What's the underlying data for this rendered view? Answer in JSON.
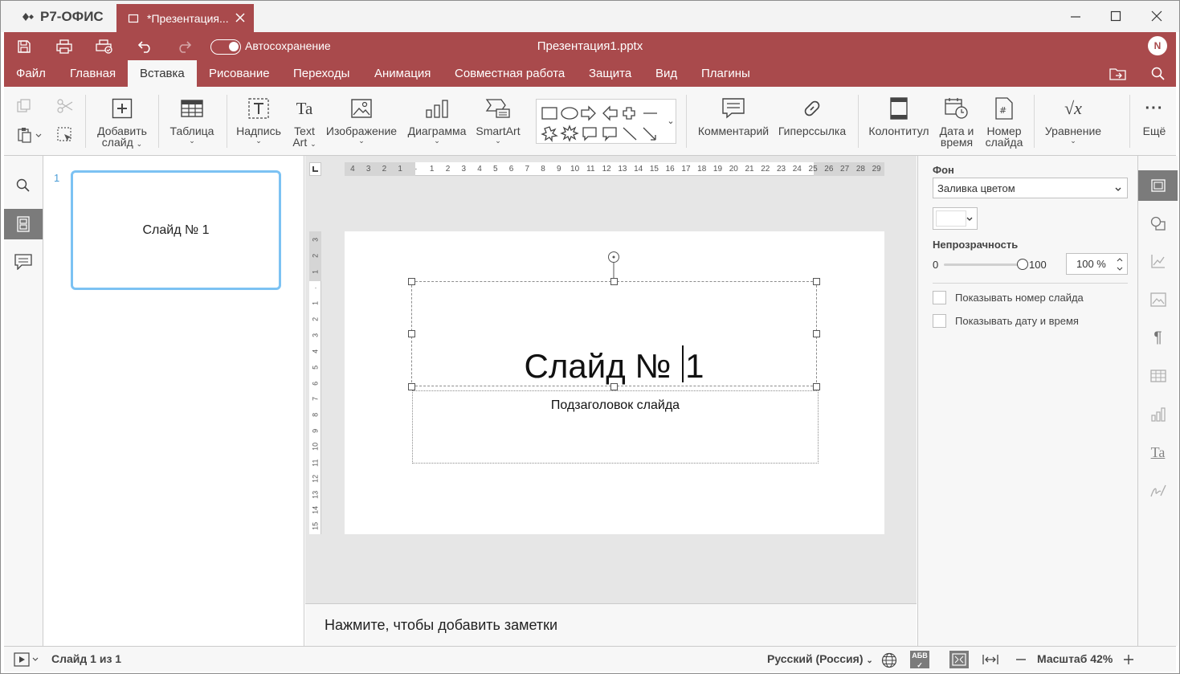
{
  "app": {
    "name": "Р7-ОФИС",
    "tab_title": "*Презентация...",
    "doc_title": "Презентация1.pptx",
    "user_initial": "N"
  },
  "redbar": {
    "autosave_label": "Автосохранение"
  },
  "menu": [
    "Файл",
    "Главная",
    "Вставка",
    "Рисование",
    "Переходы",
    "Анимация",
    "Совместная работа",
    "Защита",
    "Вид",
    "Плагины"
  ],
  "toolbar": {
    "add_slide": [
      "Добавить",
      "слайд"
    ],
    "table": "Таблица",
    "textbox": "Надпись",
    "textart": [
      "Text",
      "Art"
    ],
    "image": "Изображение",
    "chart": "Диаграмма",
    "smartart": "SmartArt",
    "comment": "Комментарий",
    "hyperlink": "Гиперссылка",
    "header_footer": "Колонтитул",
    "datetime": [
      "Дата и",
      "время"
    ],
    "slide_number": [
      "Номер",
      "слайда"
    ],
    "equation": "Уравнение",
    "more": "Ещё"
  },
  "thumbnails": [
    {
      "number": "1",
      "text": "Слайд № 1"
    }
  ],
  "ruler": {
    "h_ticks": [
      "4",
      "3",
      "2",
      "1",
      "",
      "1",
      "2",
      "3",
      "4",
      "5",
      "6",
      "7",
      "8",
      "9",
      "10",
      "11",
      "12",
      "13",
      "14",
      "15",
      "16",
      "17",
      "18",
      "19",
      "20",
      "21",
      "22",
      "23",
      "24",
      "25",
      "26",
      "27",
      "28",
      "29"
    ],
    "v_ticks": [
      "3",
      "2",
      "1",
      "",
      "1",
      "2",
      "3",
      "4",
      "5",
      "6",
      "7",
      "8",
      "9",
      "10",
      "11",
      "12",
      "13",
      "14",
      "15"
    ]
  },
  "slide": {
    "title": "Слайд № ",
    "title_tail": "1",
    "subtitle": "Подзаголовок слайда"
  },
  "notes": {
    "placeholder": "Нажмите, чтобы добавить заметки"
  },
  "right_panel": {
    "bg_label": "Фон",
    "fill_select": "Заливка цветом",
    "fill_color": "#ffffff",
    "opacity_label": "Непрозрачность",
    "opacity_min": "0",
    "opacity_max": "100",
    "opacity_value": "100 %",
    "opacity_fraction": 1.0,
    "show_slide_number": "Показывать номер слайда",
    "show_datetime": "Показывать дату и время"
  },
  "status": {
    "slide_info": "Слайд 1 из 1",
    "language": "Русский (Россия)",
    "zoom_label": "Масштаб 42%"
  },
  "colors": {
    "brand": "#a94a4c",
    "thumb_border": "#7cc2f3"
  }
}
